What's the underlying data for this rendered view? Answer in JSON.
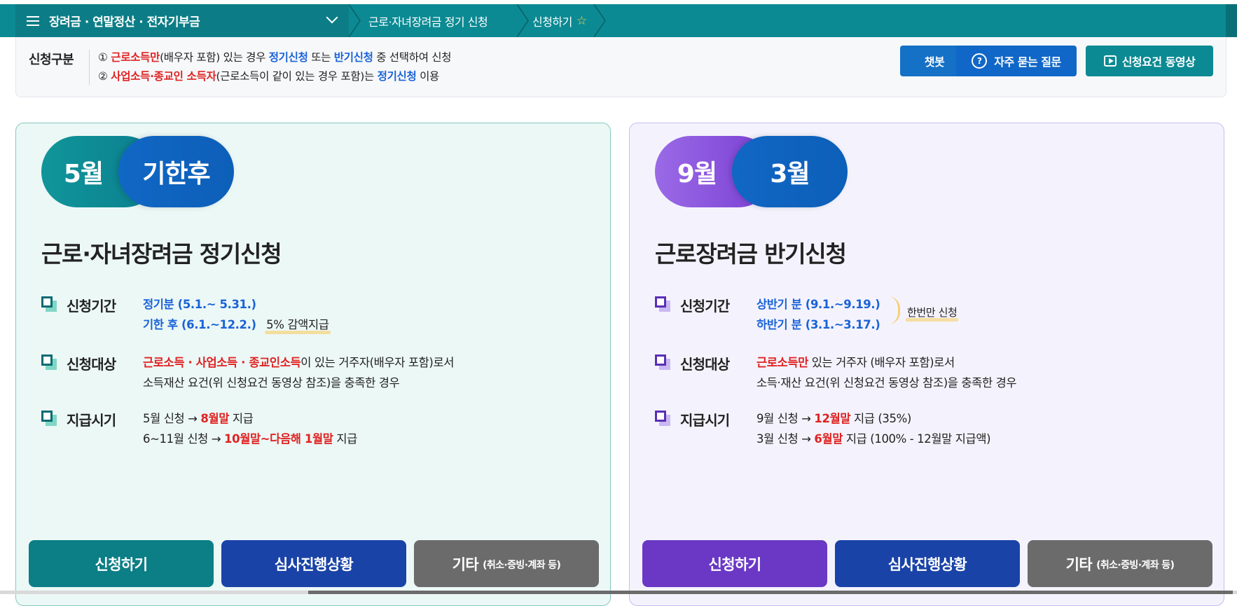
{
  "nav": {
    "home_label": "장려금 · 연말정산 · 전자기부금",
    "crumb1": "근로·자녀장려금 정기 신청",
    "crumb2": "신청하기"
  },
  "info": {
    "kind_label": "신청구분",
    "line1": {
      "num": "①",
      "a": "근로소득만",
      "b": "(배우자 포함) 있는 경우 ",
      "c": "정기신청",
      "d": " 또는 ",
      "e": "반기신청",
      "f": " 중 선택하여 신청"
    },
    "line2": {
      "num": "②",
      "a": "사업소득·종교인 소득자",
      "b": "(근로소득이 같이 있는 경우 포함)는 ",
      "c": "정기신청",
      "d": " 이용"
    },
    "buttons": {
      "chatbot": "챗봇",
      "faq": "자주 묻는 질문",
      "video": "신청요건 동영상"
    }
  },
  "left_card": {
    "pill1": "5월",
    "pill2": "기한후",
    "title": "근로·자녀장려금 정기신청",
    "period_label": "신청기간",
    "period_line1": "정기분 (5.1.~ 5.31.)",
    "period_line2": "기한 후 (6.1.~12.2.)",
    "period_note": "5% 감액지급",
    "target_label": "신청대상",
    "target_red": "근로소득 · 사업소득 · 종교인소득",
    "target_rest": "이 있는 거주자(배우자 포함)로서",
    "target_line2": "소득재산 요건(위 신청요건 동영상 참조)을 충족한 경우",
    "pay_label": "지급시기",
    "pay1_a": "5월 신청 → ",
    "pay1_b": "8월말",
    "pay1_c": " 지급",
    "pay2_a": "6~11월 신청 → ",
    "pay2_b": "10월말~다음해 1월말",
    "pay2_c": " 지급",
    "btn_apply": "신청하기",
    "btn_status": "심사진행상황",
    "btn_etc": "기타",
    "btn_etc_small": "(취소·증빙·계좌 등)"
  },
  "right_card": {
    "pill1": "9월",
    "pill2": "3월",
    "title": "근로장려금 반기신청",
    "period_label": "신청기간",
    "period_line1": "상반기 분 (9.1.~9.19.)",
    "period_line2": "하반기 분 (3.1.~3.17.)",
    "period_note": "한번만 신청",
    "target_label": "신청대상",
    "target_red": "근로소득만",
    "target_rest": " 있는 거주자 (배우자 포함)로서",
    "target_line2": "소득·재산 요건(위 신청요건 동영상 참조)을 충족한 경우",
    "pay_label": "지급시기",
    "pay1_a": "9월 신청 → ",
    "pay1_b": "12월말",
    "pay1_c": " 지급 (35%)",
    "pay2_a": "3월 신청 → ",
    "pay2_b": "6월말",
    "pay2_c": " 지급 (100% - 12월말 지급액)",
    "btn_apply": "신청하기",
    "btn_status": "심사진행상황",
    "btn_etc": "기타",
    "btn_etc_small": "(취소·증빙·계좌 등)"
  },
  "colors": {
    "nav_bg": "#0b8a93",
    "teal": "#0b7e86",
    "navy": "#1a43a8",
    "gray": "#6b6b6b",
    "purple": "#6a38c5",
    "red": "#e02323",
    "blue": "#1a63d8"
  }
}
